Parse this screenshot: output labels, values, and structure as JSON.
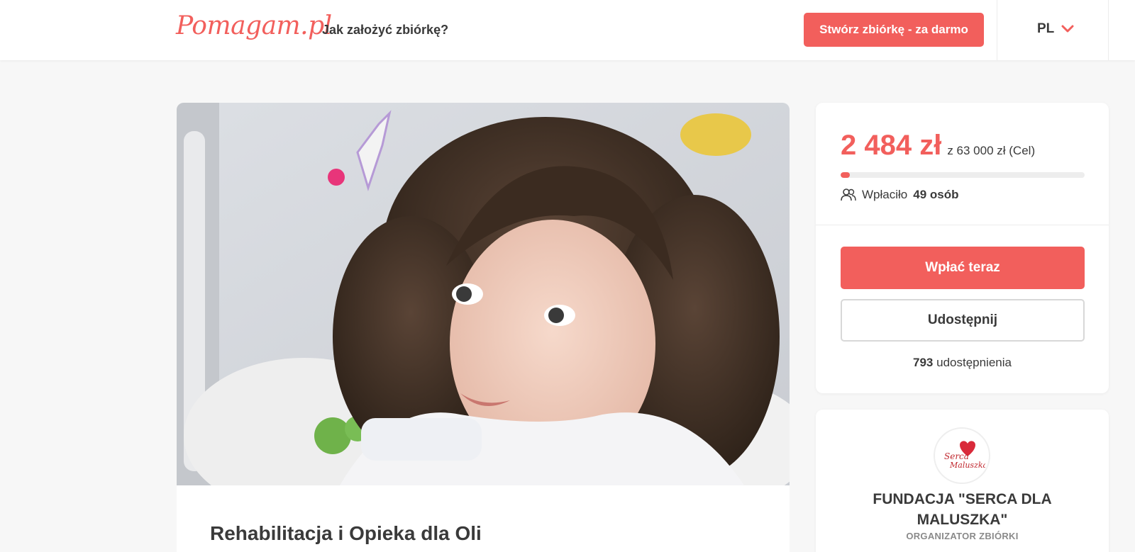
{
  "header": {
    "logo": "Pomagam.pl",
    "how_link": "Jak założyć zbiórkę?",
    "create_button": "Stwórz zbiórkę - za darmo",
    "language": "PL"
  },
  "campaign": {
    "title": "Rehabilitacja i Opieka dla Oli",
    "photo_alt": "girl-in-hospital-bed-photo"
  },
  "donation": {
    "amount": "2 484 zł",
    "goal": "z 63 000 zł (Cel)",
    "progress_fraction": 0.039,
    "donors_prefix": "Wpłaciło",
    "donors_count": "49 osób",
    "donate_button": "Wpłać teraz",
    "share_button": "Udostępnij",
    "shares_count": "793",
    "shares_label": "udostępnienia"
  },
  "organizer": {
    "name": "FUNDACJA \"SERCA DLA MALUSZKA\"",
    "role": "ORGANIZATOR ZBIÓRKI",
    "logo_text": "Serca dla Maluszka"
  },
  "colors": {
    "accent": "#f25f5c",
    "text": "#3a3a3a",
    "background": "#f7f7f7"
  },
  "icons": {
    "lang_chevron": "chevron-down-icon",
    "donors": "users-icon"
  }
}
